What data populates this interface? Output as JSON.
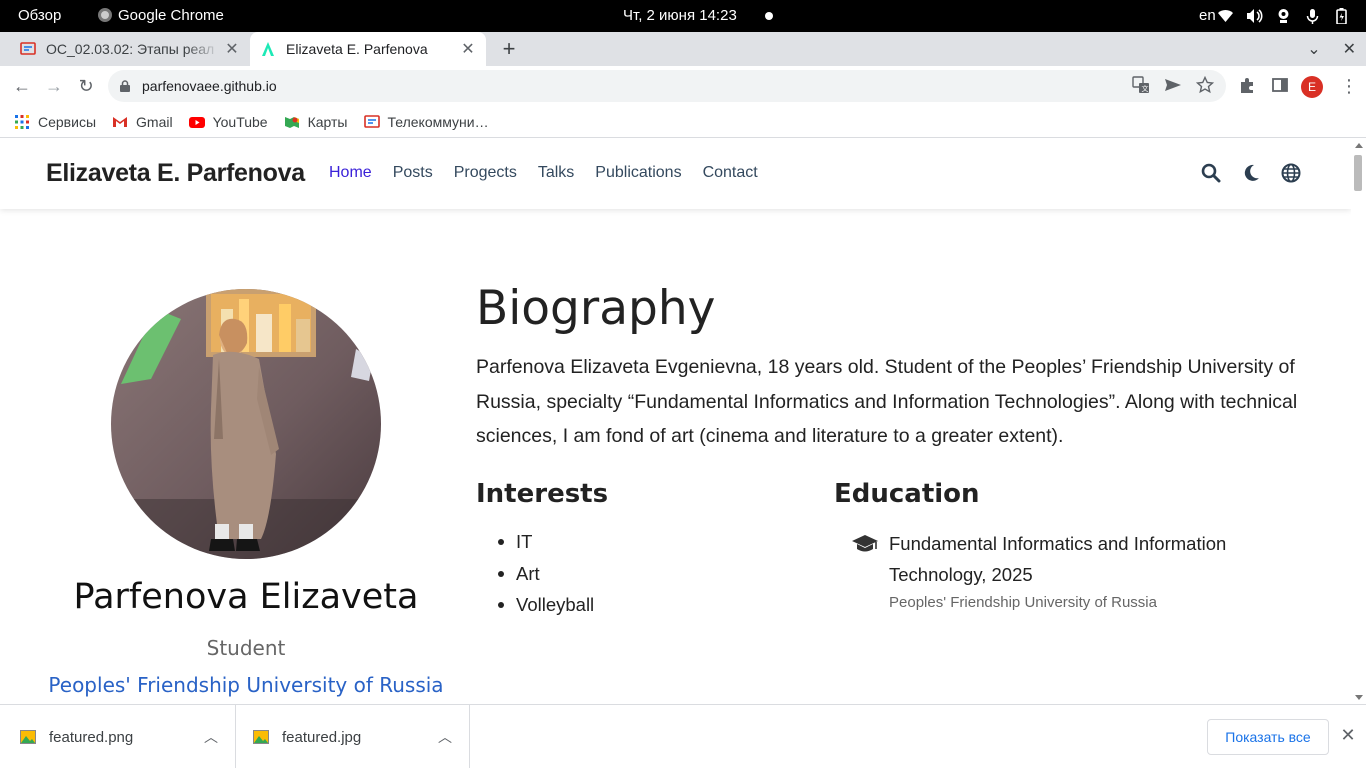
{
  "system": {
    "activities": "Обзор",
    "app": "Google Chrome",
    "clock": "Чт, 2 июня  14:23",
    "lang": "en"
  },
  "browser": {
    "tabs": [
      {
        "title": "ОС_02.03.02: Этапы реал",
        "active": false
      },
      {
        "title": "Elizaveta E. Parfenova",
        "active": true
      }
    ],
    "url": "parfenovaee.github.io",
    "profile_initial": "E",
    "bookmarks": [
      {
        "label": "Сервисы",
        "icon": "apps-grid-icon"
      },
      {
        "label": "Gmail",
        "icon": "gmail-icon"
      },
      {
        "label": "YouTube",
        "icon": "youtube-icon"
      },
      {
        "label": "Карты",
        "icon": "maps-icon"
      },
      {
        "label": "Телекоммуни…",
        "icon": "telecom-icon"
      }
    ]
  },
  "site": {
    "brand": "Elizaveta E. Parfenova",
    "nav": [
      "Home",
      "Posts",
      "Progects",
      "Talks",
      "Publications",
      "Contact"
    ],
    "active_nav": "Home",
    "accent_color": "#3b22d8"
  },
  "profile": {
    "name": "Parfenova Elizaveta",
    "role": "Student",
    "organization": "Peoples' Friendship University of Russia"
  },
  "biography": {
    "title": "Biography",
    "text": "Parfenova Elizaveta Evgenievna, 18 years old. Student of the Peoples’ Friendship University of Russia, specialty “Fundamental Informatics and Information Technologies”. Along with technical sciences, I am fond of art (cinema and literature to a greater extent)."
  },
  "interests": {
    "title": "Interests",
    "items": [
      "IT",
      "Art",
      "Volleyball"
    ]
  },
  "education": {
    "title": "Education",
    "items": [
      {
        "course": "Fundamental Informatics and Information Technology, 2025",
        "institution": "Peoples' Friendship University of Russia"
      }
    ]
  },
  "downloads": {
    "items": [
      "featured.png",
      "featured.jpg"
    ],
    "show_all": "Показать все"
  }
}
